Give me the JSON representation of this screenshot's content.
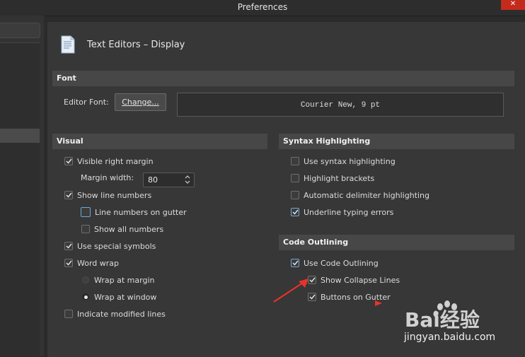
{
  "window": {
    "title": "Preferences",
    "close_label": "✕"
  },
  "page": {
    "title": "Text Editors – Display"
  },
  "font_section": {
    "header": "Font",
    "editor_font_label": "Editor Font:",
    "change_button": "Change...",
    "preview": "Courier New, 9 pt"
  },
  "visual": {
    "header": "Visual",
    "visible_right_margin": {
      "label": "Visible right margin",
      "checked": true
    },
    "margin_width": {
      "label": "Margin width:",
      "value": "80"
    },
    "show_line_numbers": {
      "label": "Show line numbers",
      "checked": true
    },
    "line_numbers_on_gutter": {
      "label": "Line numbers on gutter",
      "checked": false
    },
    "show_all_numbers": {
      "label": "Show all numbers",
      "checked": false
    },
    "use_special_symbols": {
      "label": "Use special symbols",
      "checked": true
    },
    "word_wrap": {
      "label": "Word wrap",
      "checked": true
    },
    "wrap_at_margin": {
      "label": "Wrap at margin",
      "selected": false
    },
    "wrap_at_window": {
      "label": "Wrap at window",
      "selected": true
    },
    "indicate_modified_lines": {
      "label": "Indicate modified lines",
      "checked": false
    }
  },
  "syntax": {
    "header": "Syntax Highlighting",
    "use_syntax_highlighting": {
      "label": "Use syntax highlighting",
      "checked": false
    },
    "highlight_brackets": {
      "label": "Highlight brackets",
      "checked": false
    },
    "automatic_delimiter": {
      "label": "Automatic delimiter highlighting",
      "checked": false
    },
    "underline_typing_errors": {
      "label": "Underline typing errors",
      "checked": true
    }
  },
  "outlining": {
    "header": "Code Outlining",
    "use_code_outlining": {
      "label": "Use Code Outlining",
      "checked": true
    },
    "show_collapse_lines": {
      "label": "Show Collapse Lines",
      "checked": true
    },
    "buttons_on_gutter": {
      "label": "Buttons on Gutter",
      "checked": true
    }
  },
  "watermark": {
    "text": "Bai经验",
    "url": "jingyan.baidu.com"
  },
  "colors": {
    "accent": "#6fa7d9",
    "annotation_arrow": "#e8322b",
    "close": "#c42b1c"
  }
}
